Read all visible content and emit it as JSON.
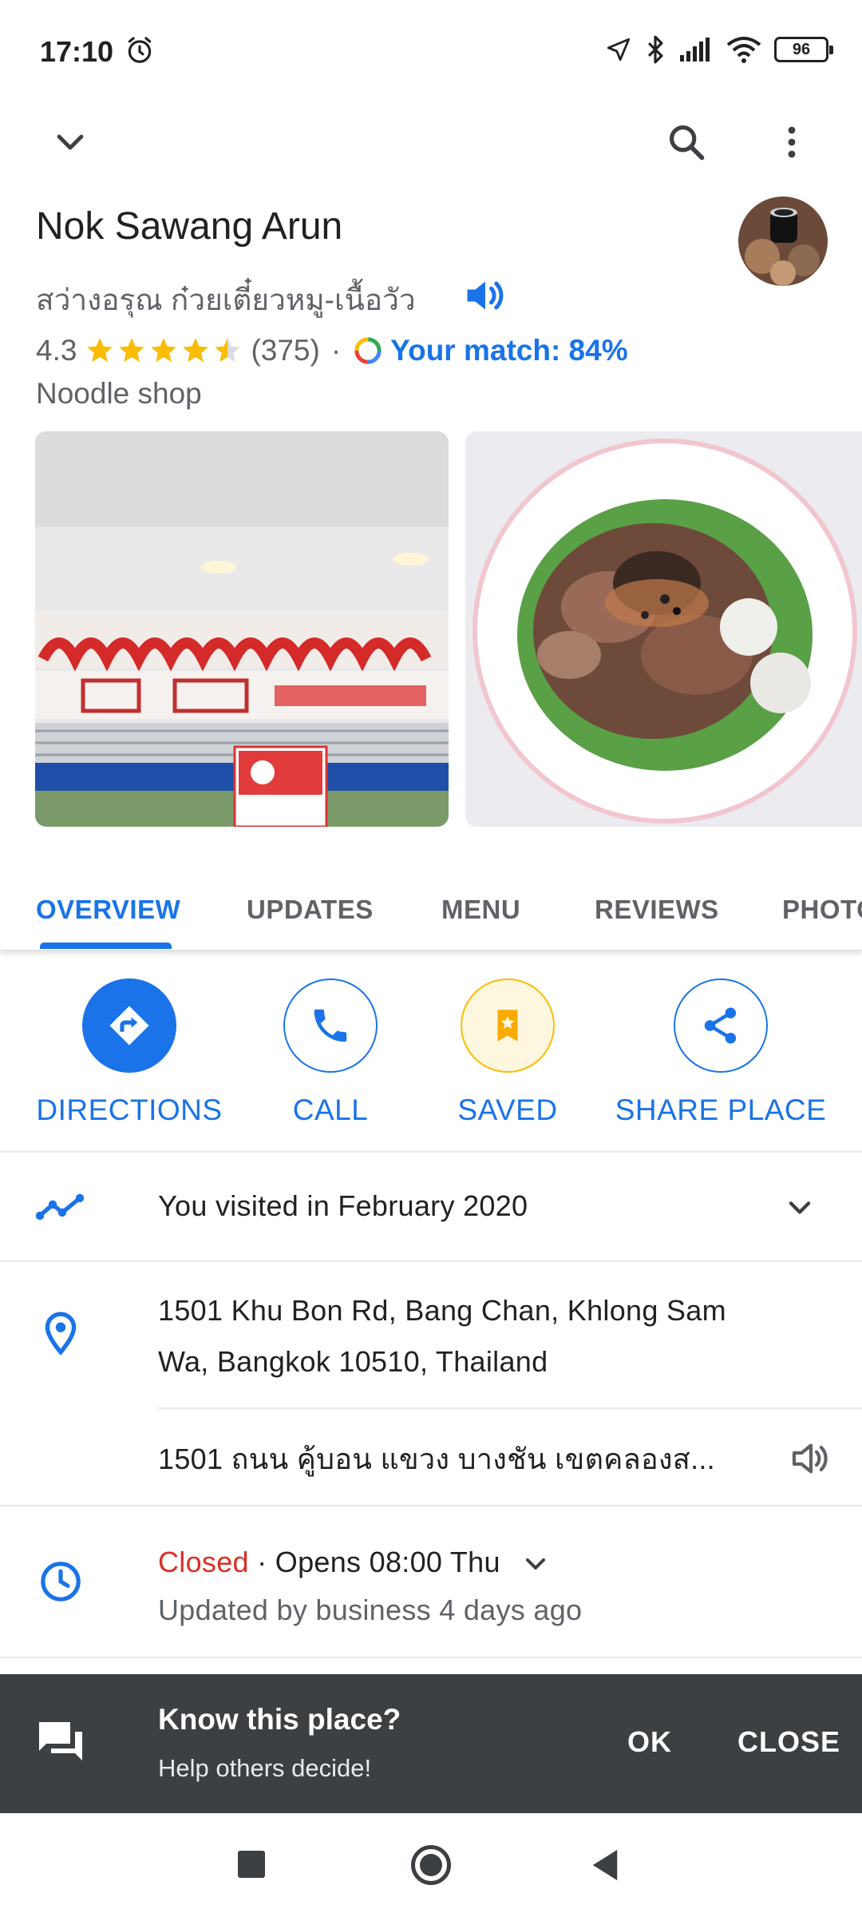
{
  "status_bar": {
    "time": "17:10",
    "battery": "96"
  },
  "place": {
    "name": "Nok Sawang Arun",
    "local_name": "สว่างอรุณ ก๋วยเตี๋ยวหมู-เนื้อวัว",
    "rating": "4.3",
    "stars_value": 4.3,
    "review_count": "(375)",
    "separator": "·",
    "match_text": "Your match: 84%",
    "category": "Noodle shop"
  },
  "tabs": [
    "OVERVIEW",
    "UPDATES",
    "MENU",
    "REVIEWS",
    "PHOTOS"
  ],
  "actions": {
    "directions": "DIRECTIONS",
    "call": "CALL",
    "saved": "SAVED",
    "share": "SHARE PLACE"
  },
  "visited": {
    "text": "You visited in February 2020"
  },
  "address": {
    "line1": "1501 Khu Bon Rd, Bang Chan, Khlong Sam",
    "line2": "Wa, Bangkok 10510, Thailand",
    "local": "1501 ถนน คู้บอน แขวง บางชัน เขตคลองส..."
  },
  "hours": {
    "status": "Closed",
    "opens": " · Opens 08:00 Thu",
    "updated": "Updated by business 4 days ago"
  },
  "snackbar": {
    "title": "Know this place?",
    "subtitle": "Help others decide!",
    "ok": "OK",
    "close": "CLOSE"
  },
  "colors": {
    "accent": "#1a73e8",
    "closed": "#d93025",
    "star": "#fbbc04",
    "saved_bg": "#fef7e0"
  },
  "icons": {
    "back": "chevron-down-icon",
    "search": "search-icon",
    "menu": "more-vert-icon",
    "speaker": "speaker-icon",
    "directions": "directions-icon",
    "call": "phone-icon",
    "saved": "bookmark-star-icon",
    "share": "share-icon",
    "visited": "timeline-icon",
    "address": "location-pin-icon",
    "hours": "clock-icon",
    "feedback": "feedback-icon"
  }
}
